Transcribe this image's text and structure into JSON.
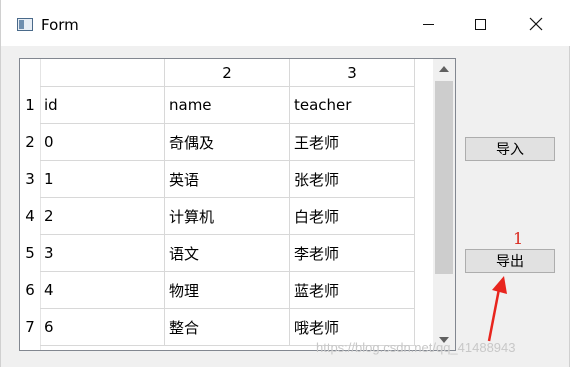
{
  "window": {
    "title": "Form",
    "accent": "#d9281e"
  },
  "table": {
    "column_headers": [
      "",
      "2",
      "3"
    ],
    "row_numbers": [
      "1",
      "2",
      "3",
      "4",
      "5",
      "6",
      "7"
    ],
    "rows": [
      [
        "id",
        "name",
        "teacher"
      ],
      [
        "0",
        "奇偶及",
        "王老师"
      ],
      [
        "1",
        "英语",
        "张老师"
      ],
      [
        "2",
        "计算机",
        "白老师"
      ],
      [
        "3",
        "语文",
        "李老师"
      ],
      [
        "4",
        "物理",
        "蓝老师"
      ],
      [
        "6",
        "整合",
        "哦老师"
      ]
    ]
  },
  "buttons": {
    "import_label": "导入",
    "export_label": "导出"
  },
  "annotation": {
    "label": "1"
  },
  "watermark": "https://blog.csdn.net/qq_41488943"
}
